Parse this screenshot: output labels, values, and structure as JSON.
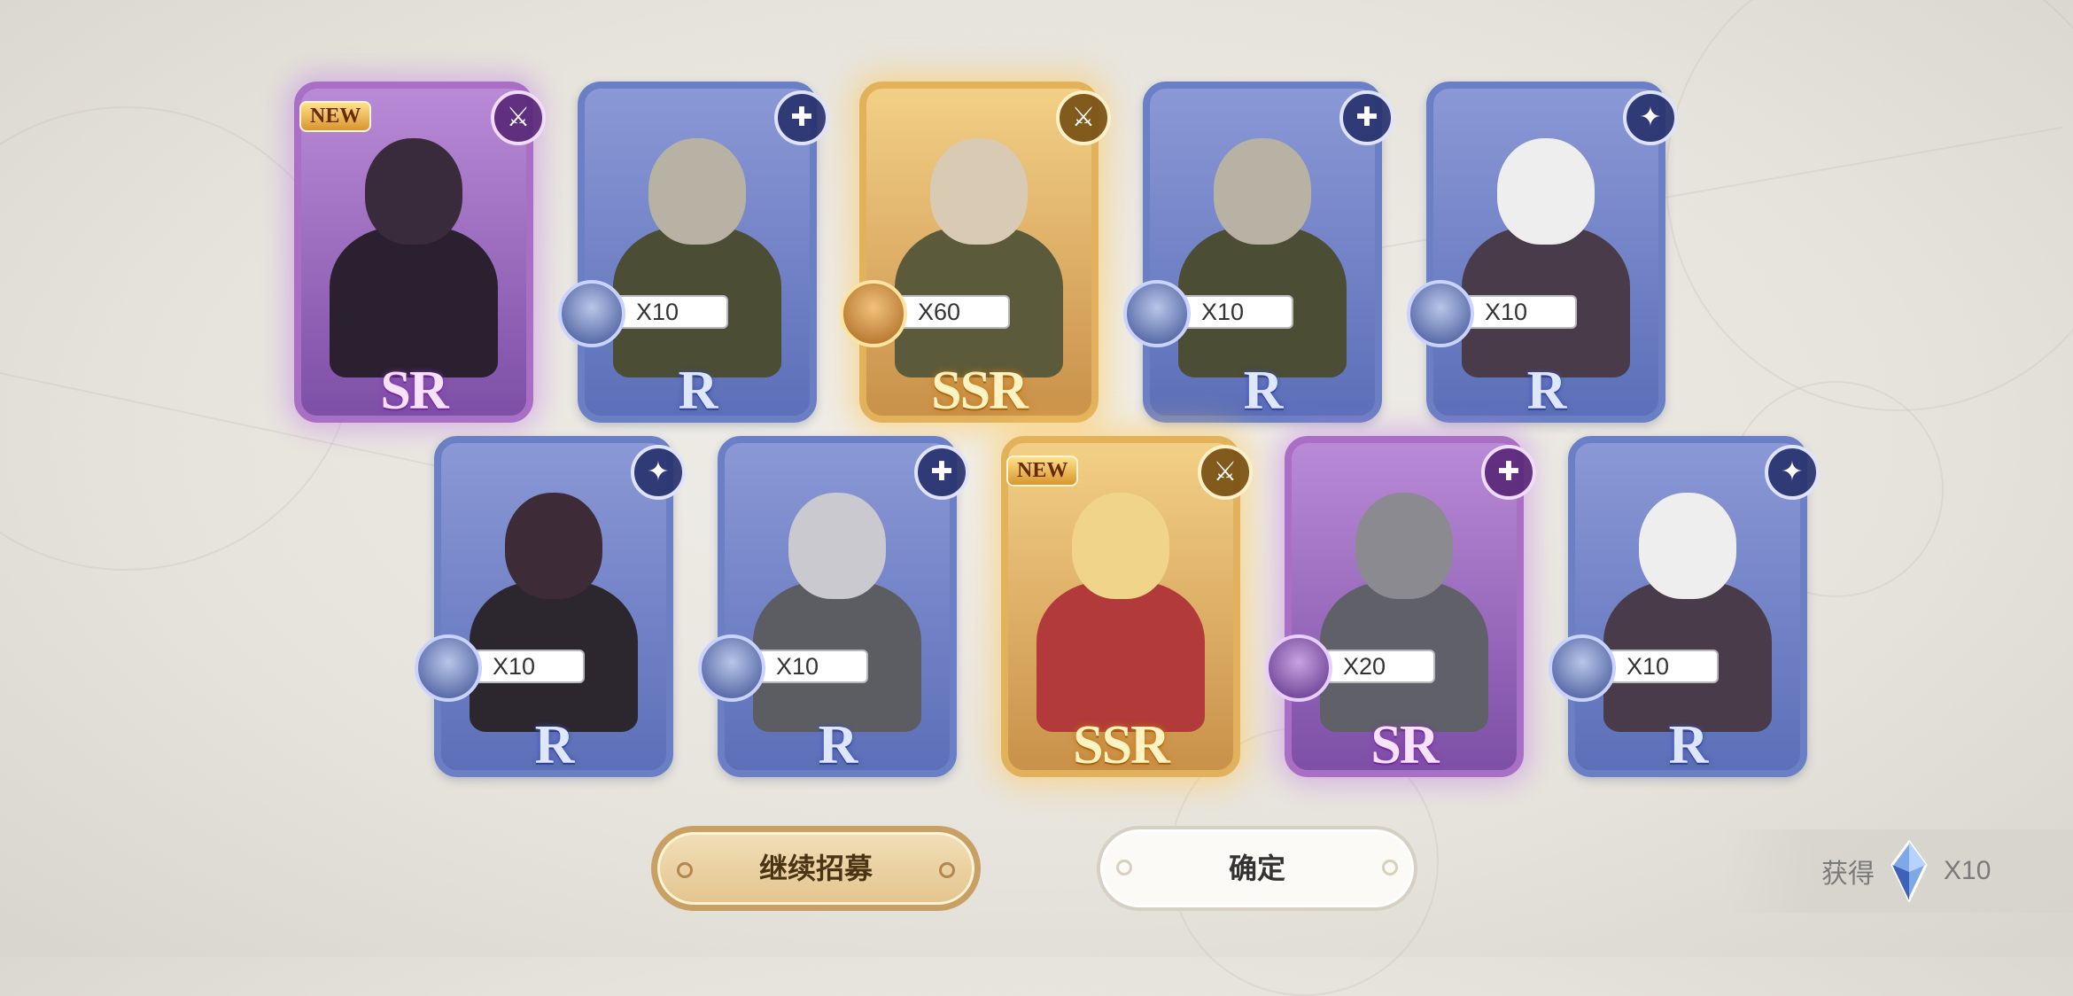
{
  "cards": [
    {
      "rarity": "SR",
      "class_icon": "sword-arrows-icon",
      "is_new": true,
      "new_label": "NEW",
      "shard_count": null
    },
    {
      "rarity": "R",
      "class_icon": "shield-cross-icon",
      "is_new": false,
      "new_label": "",
      "shard_count": "X10"
    },
    {
      "rarity": "SSR",
      "class_icon": "sword-arrows-icon",
      "is_new": false,
      "new_label": "",
      "shard_count": "X60"
    },
    {
      "rarity": "R",
      "class_icon": "shield-cross-icon",
      "is_new": false,
      "new_label": "",
      "shard_count": "X10"
    },
    {
      "rarity": "R",
      "class_icon": "sparkle-icon",
      "is_new": false,
      "new_label": "",
      "shard_count": "X10"
    },
    {
      "rarity": "R",
      "class_icon": "sparkle-icon",
      "is_new": false,
      "new_label": "",
      "shard_count": "X10"
    },
    {
      "rarity": "R",
      "class_icon": "shield-cross-icon",
      "is_new": false,
      "new_label": "",
      "shard_count": "X10"
    },
    {
      "rarity": "SSR",
      "class_icon": "sword-arrows-icon",
      "is_new": true,
      "new_label": "NEW",
      "shard_count": null
    },
    {
      "rarity": "SR",
      "class_icon": "shield-cross-icon",
      "is_new": false,
      "new_label": "",
      "shard_count": "X20"
    },
    {
      "rarity": "R",
      "class_icon": "sparkle-icon",
      "is_new": false,
      "new_label": "",
      "shard_count": "X10"
    }
  ],
  "buttons": {
    "continue_label": "继续招募",
    "confirm_label": "确定"
  },
  "reward": {
    "label": "获得",
    "icon": "crystal-gem-icon",
    "amount": "X10"
  },
  "colors": {
    "r_frame": "#6b7fc4",
    "sr_frame": "#a86fc4",
    "ssr_frame": "#e2b15c"
  }
}
